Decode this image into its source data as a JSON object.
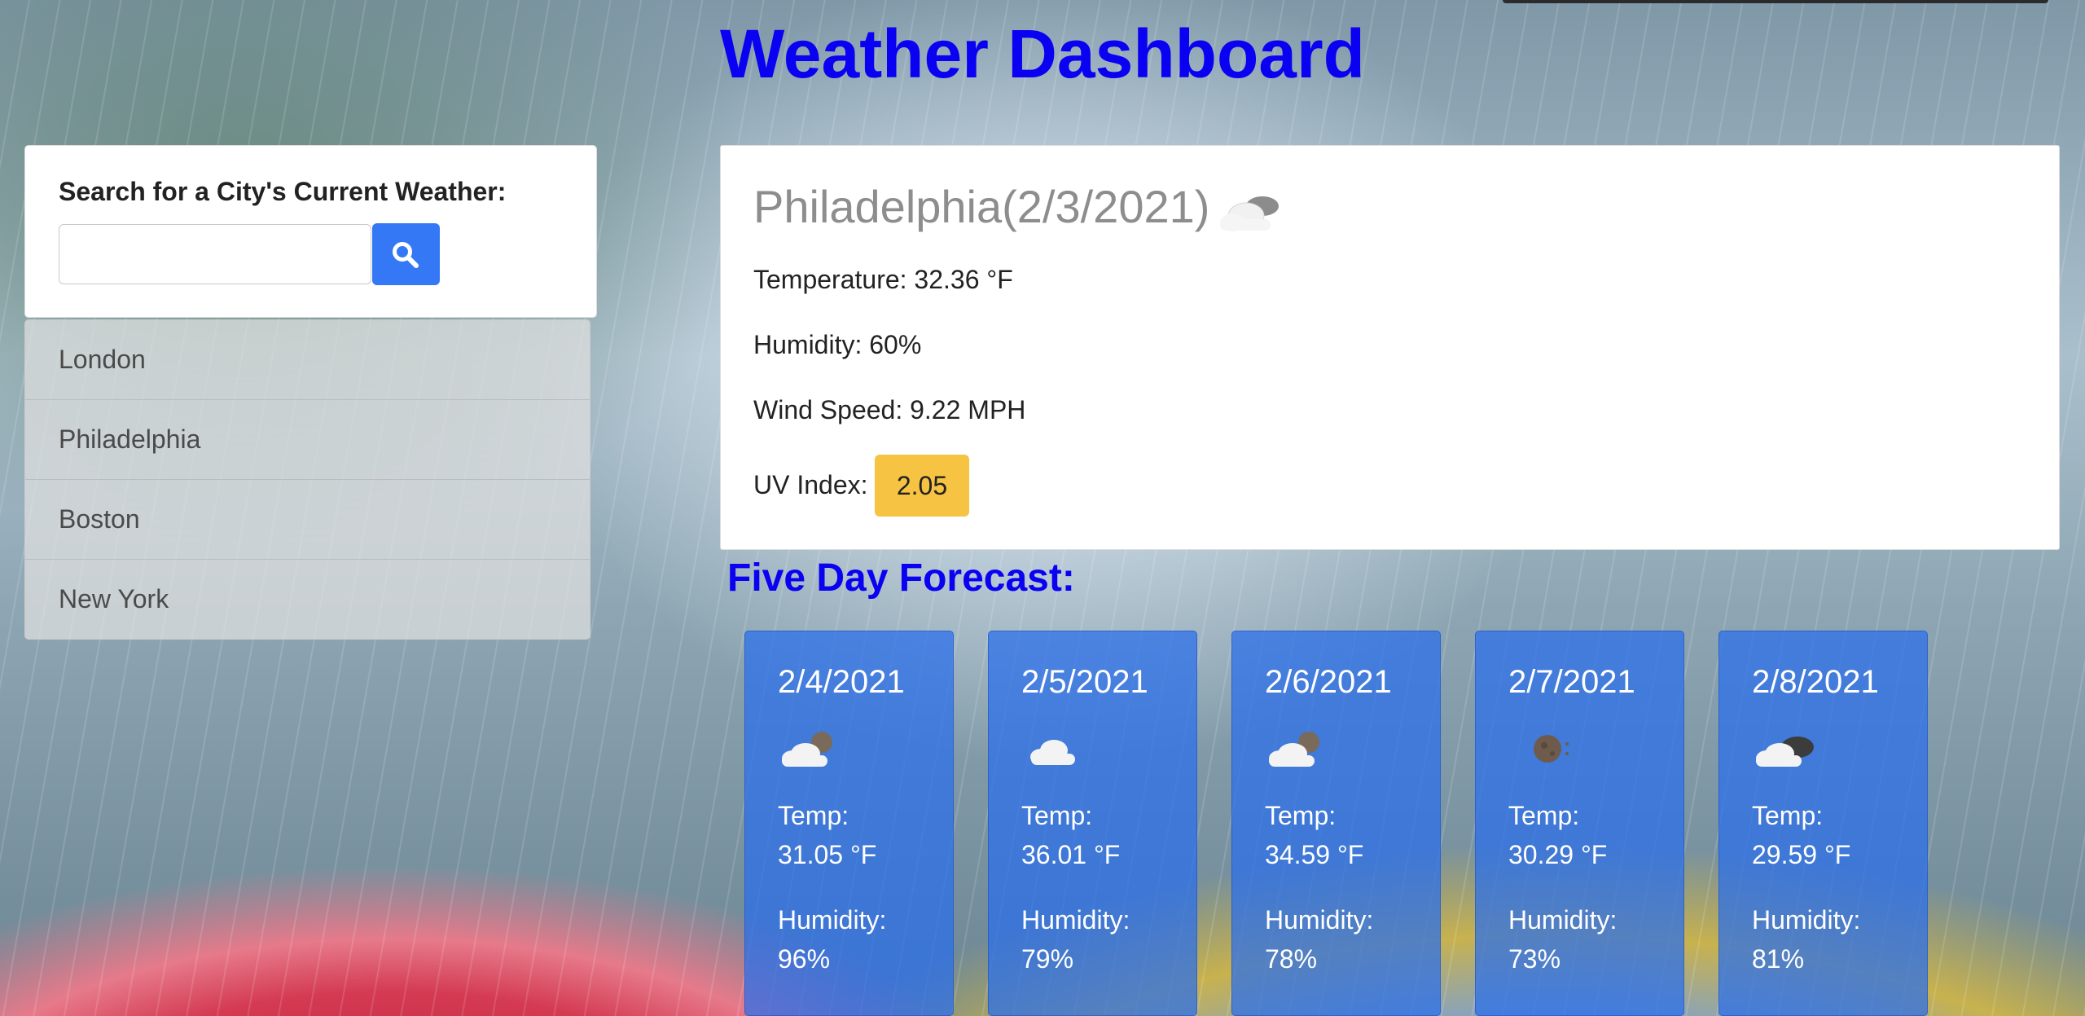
{
  "header": {
    "title": "Weather Dashboard"
  },
  "search": {
    "label": "Search for a City's Current Weather:",
    "value": "",
    "placeholder": ""
  },
  "history": [
    "London",
    "Philadelphia",
    "Boston",
    "New York"
  ],
  "current": {
    "title": "Philadelphia(2/3/2021)",
    "icon": "cloudy-icon",
    "temperature": "Temperature: 32.36 °F",
    "humidity": "Humidity: 60%",
    "wind": "Wind Speed: 9.22 MPH",
    "uv_label": "UV Index:",
    "uv_value": "2.05",
    "uv_color": "#f6c343"
  },
  "forecast": {
    "title": "Five Day Forecast:",
    "days": [
      {
        "date": "2/4/2021",
        "icon": "cloudy-night-icon",
        "temp_label": "Temp:",
        "temp": "31.05 °F",
        "hum_label": "Humidity:",
        "humidity": "96%"
      },
      {
        "date": "2/5/2021",
        "icon": "cloud-icon",
        "temp_label": "Temp:",
        "temp": "36.01 °F",
        "hum_label": "Humidity:",
        "humidity": "79%"
      },
      {
        "date": "2/6/2021",
        "icon": "cloudy-night-icon",
        "temp_label": "Temp:",
        "temp": "34.59 °F",
        "hum_label": "Humidity:",
        "humidity": "78%"
      },
      {
        "date": "2/7/2021",
        "icon": "clear-night-icon",
        "temp_label": "Temp:",
        "temp": "30.29 °F",
        "hum_label": "Humidity:",
        "humidity": "73%"
      },
      {
        "date": "2/8/2021",
        "icon": "dark-clouds-icon",
        "temp_label": "Temp:",
        "temp": "29.59 °F",
        "hum_label": "Humidity:",
        "humidity": "81%"
      }
    ]
  },
  "colors": {
    "title": "#0a00f2",
    "search_button": "#3578f6",
    "forecast_card": "#286eeb"
  }
}
